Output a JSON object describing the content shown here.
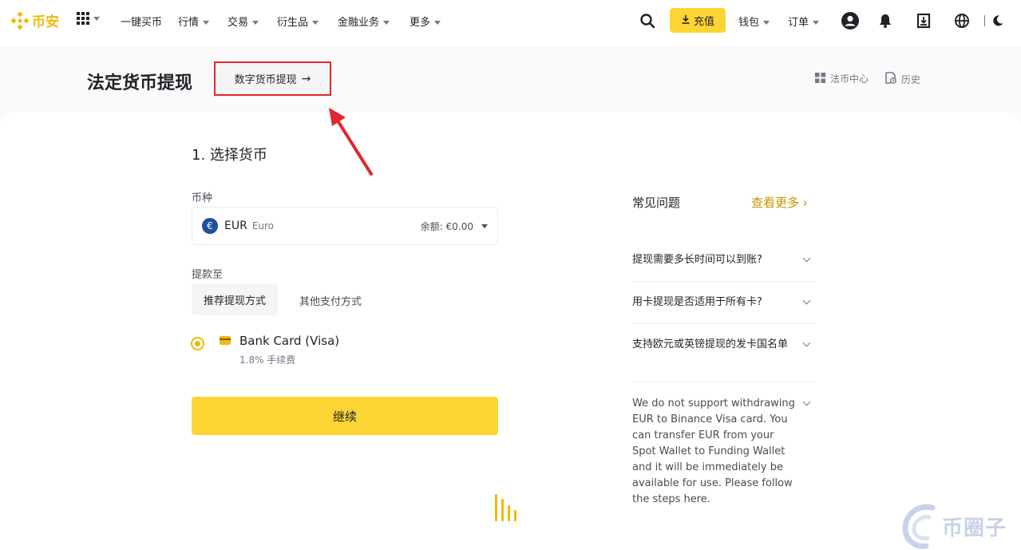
{
  "nav": {
    "logo_text": "币安",
    "items": [
      {
        "label": "一键买币",
        "caret": false
      },
      {
        "label": "行情",
        "caret": true
      },
      {
        "label": "交易",
        "caret": true
      },
      {
        "label": "衍生品",
        "caret": true
      },
      {
        "label": "金融业务",
        "caret": true
      },
      {
        "label": "更多",
        "caret": true
      }
    ],
    "deposit_label": "充值",
    "wallet_label": "钱包",
    "orders_label": "订单",
    "icons": [
      "search-icon",
      "user-icon",
      "bell-icon",
      "download-app-icon",
      "globe-icon",
      "moon-icon"
    ]
  },
  "header": {
    "title": "法定货币提现",
    "crypto_withdraw_label": "数字货币提现",
    "fiat_center_label": "法币中心",
    "history_label": "历史"
  },
  "form": {
    "step_title": "1. 选择货币",
    "currency_label": "币种",
    "currency": {
      "symbol": "€",
      "code": "EUR",
      "name": "Euro",
      "balance": "余额: €0.00"
    },
    "withdraw_to_label": "提款至",
    "tabs": [
      "推荐提现方式",
      "其他支付方式"
    ],
    "method": {
      "name": "Bank Card (Visa)",
      "fee": "1.8% 手续费"
    },
    "continue_label": "继续"
  },
  "faq": {
    "title": "常见问题",
    "more_label": "查看更多 ›",
    "items": [
      "提现需要多长时间可以到账?",
      "用卡提现是否适用于所有卡?",
      "支持欧元或英镑提现的发卡国名单"
    ],
    "note": "We do not support withdrawing EUR to Binance Visa card. You can transfer EUR from your Spot Wallet to Funding Wallet and it will be immediately be available for use. Please follow the steps here."
  },
  "watermark": {
    "text": "币圈子"
  },
  "colors": {
    "brand_yellow": "#fcd535",
    "brand_gold": "#f0b90b",
    "annotation_red": "#e0282e",
    "text_primary": "#1e2329",
    "text_secondary": "#707a8a"
  }
}
